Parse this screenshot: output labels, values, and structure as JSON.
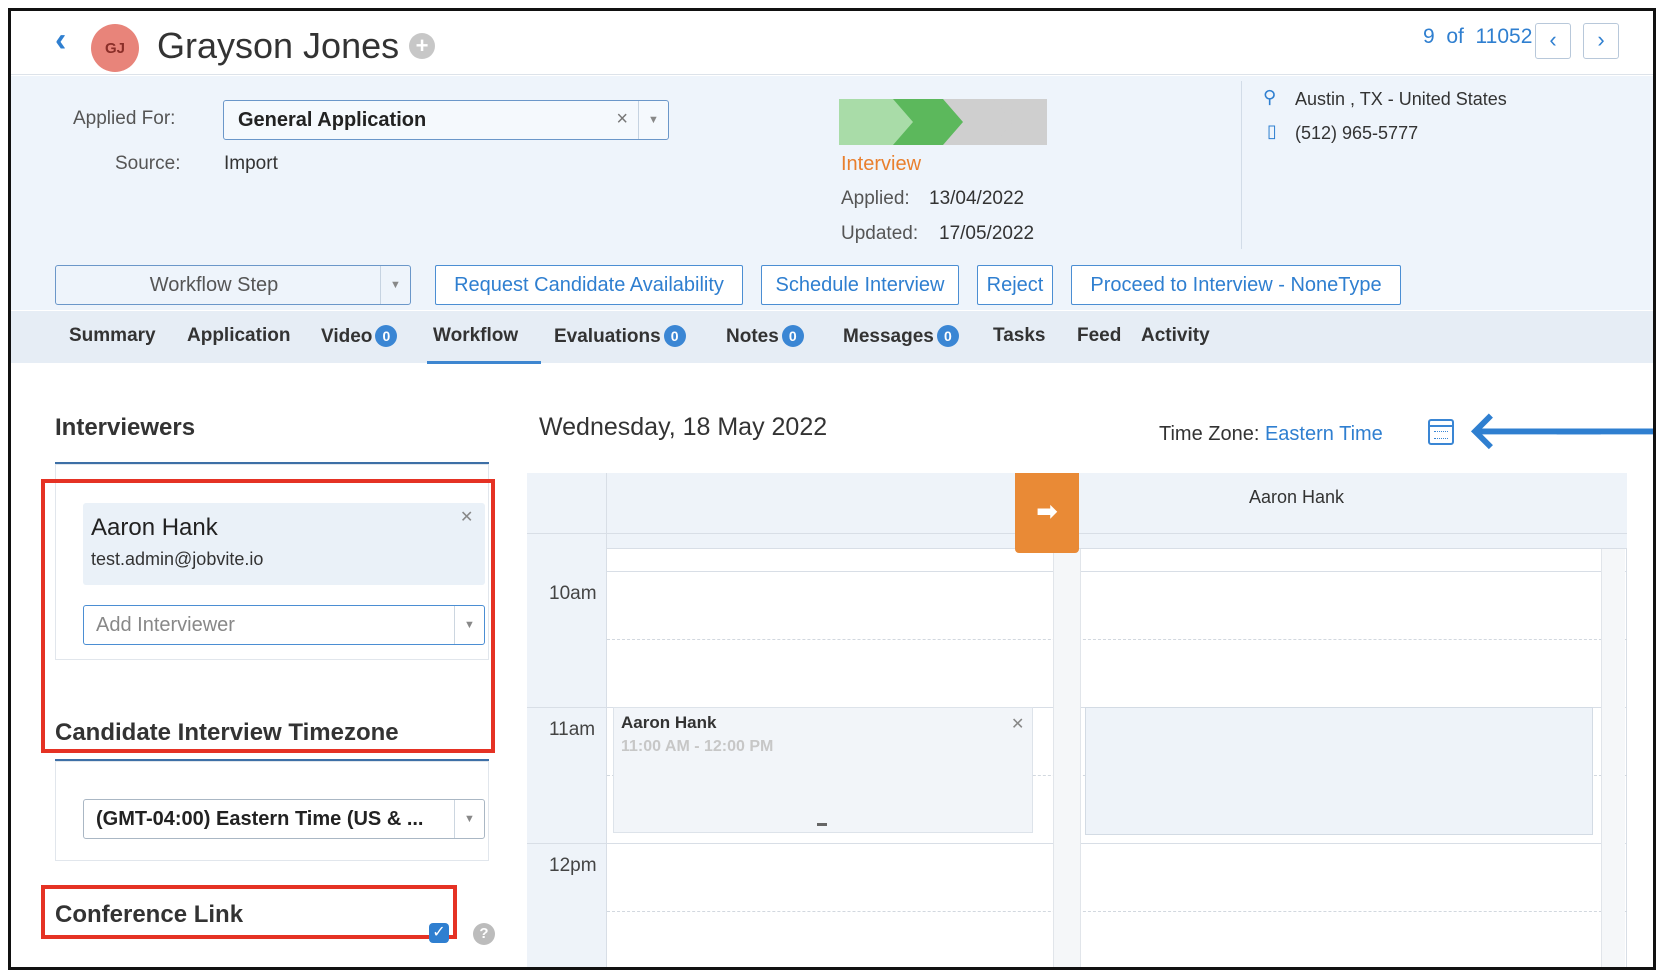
{
  "header": {
    "avatar_initials": "GJ",
    "candidate_name": "Grayson Jones",
    "pager": "9  of  11052"
  },
  "info": {
    "applied_for_label": "Applied For:",
    "applied_for_value": "General Application",
    "source_label": "Source:",
    "source_value": "Import",
    "stage": "Interview",
    "applied_label": "Applied:",
    "applied_date": "13/04/2022",
    "updated_label": "Updated:",
    "updated_date": "17/05/2022",
    "location": "Austin , TX - United States",
    "phone": "(512) 965-5777",
    "progress_steps_done": 2,
    "progress_steps_total": 4
  },
  "actions": {
    "workflow_step": "Workflow Step",
    "request_availability": "Request Candidate Availability",
    "schedule_interview": "Schedule Interview",
    "reject": "Reject",
    "proceed": "Proceed to Interview - NoneType"
  },
  "tabs": [
    {
      "label": "Summary"
    },
    {
      "label": "Application"
    },
    {
      "label": "Video",
      "count": "0"
    },
    {
      "label": "Workflow",
      "active": true
    },
    {
      "label": "Evaluations",
      "count": "0"
    },
    {
      "label": "Notes",
      "count": "0"
    },
    {
      "label": "Messages",
      "count": "0"
    },
    {
      "label": "Tasks"
    },
    {
      "label": "Feed"
    },
    {
      "label": "Activity"
    }
  ],
  "interviewers": {
    "title": "Interviewers",
    "items": [
      {
        "name": "Aaron Hank",
        "email": "test.admin@jobvite.io"
      }
    ],
    "add_placeholder": "Add Interviewer"
  },
  "timezone": {
    "title": "Candidate Interview Timezone",
    "value": "(GMT-04:00) Eastern Time (US & ..."
  },
  "conference": {
    "title": "Conference Link",
    "checked": true
  },
  "calendar": {
    "date": "Wednesday, 18 May 2022",
    "tz_label": "Time Zone:",
    "tz_value": "Eastern Time",
    "column_header": "Aaron Hank",
    "hours": [
      "10am",
      "11am",
      "12pm"
    ],
    "event": {
      "title": "Aaron Hank",
      "time": "11:00 AM - 12:00 PM"
    }
  },
  "colors": {
    "accent": "#2f7fd0",
    "stage_orange": "#e97f2d",
    "highlight_red": "#e53224",
    "progress_light": "#a9dca8",
    "progress_dark": "#5cb85c"
  }
}
